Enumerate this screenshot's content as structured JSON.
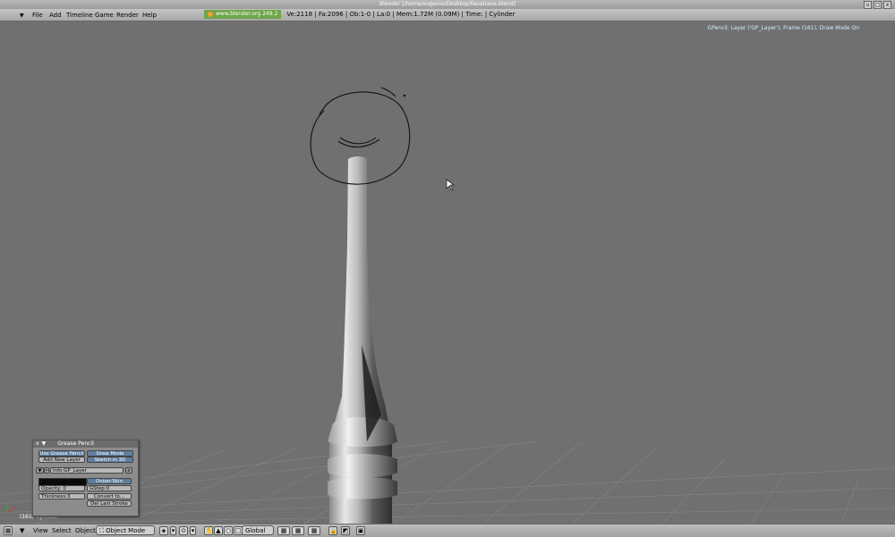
{
  "window": {
    "title": "Blender [/home/eugenio/Desktop/llavairane.blend]",
    "controls": [
      "▫",
      "□",
      "x"
    ]
  },
  "menubar": {
    "items": [
      "File",
      "Add",
      "Timeline",
      "Game",
      "Render",
      "Help"
    ],
    "logo_text": "www.blender.org 249.2",
    "stats": "Ve:2118 | Fa:2096 | Ob:1-0 | La:0  | Mem:1.72M (0.09M)  | Time:  | Cylinder"
  },
  "viewport": {
    "gpencil_info": "GPencil: Layer ('GP_Layer'), Frame (161), Draw Mode On",
    "object_label": "(161) Cylinder"
  },
  "grease_panel": {
    "title": "Grease Pencil",
    "use_button": "Use Grease Pencil",
    "draw_mode": "Draw Mode",
    "add_layer": "Add New Layer",
    "sketch_3d": "Sketch in 3D",
    "layer_name": "Info:GP_Layer",
    "onion": "Onion-Skin",
    "opacity": "Opacity: 0",
    "gstep": "GStep:0",
    "thickness": "Thickness:3",
    "convert": "Convert to...",
    "del_stroke": "Del Last Stroke"
  },
  "header": {
    "menus": [
      "View",
      "Select",
      "Object"
    ],
    "mode": "Object Mode",
    "orientation": "Global"
  }
}
